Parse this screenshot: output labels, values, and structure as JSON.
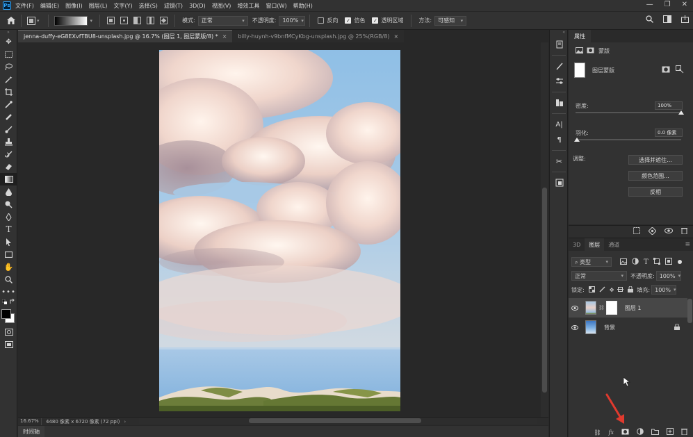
{
  "app": {
    "logo": "Ps"
  },
  "menu": [
    "文件(F)",
    "编辑(E)",
    "图像(I)",
    "图层(L)",
    "文字(Y)",
    "选择(S)",
    "滤镜(T)",
    "3D(D)",
    "视图(V)",
    "增效工具",
    "窗口(W)",
    "帮助(H)"
  ],
  "window_controls": {
    "minimize": "—",
    "restore": "❐",
    "close": "✕"
  },
  "options": {
    "mode_label": "模式:",
    "mode_value": "正常",
    "opacity_label": "不透明度:",
    "opacity_value": "100%",
    "reverse_label": "反向",
    "dither_label": "仿色",
    "transparency_label": "透明区域",
    "method_label": "方法:",
    "method_value": "可感知"
  },
  "tabs": [
    {
      "label": "jenna-duffy-eG8EXvfTBU8-unsplash.jpg @ 16.7% (图层 1, 图层蒙版/8) *",
      "close": "×"
    },
    {
      "label": "billy-huynh-v9bnfMCyKbg-unsplash.jpg @ 25%(RGB/8)",
      "close": "×"
    }
  ],
  "status": {
    "zoom": "16.67%",
    "info": "4480 像素 x 6720 像素 (72 ppi)"
  },
  "timeline": {
    "label": "时间轴"
  },
  "properties": {
    "tab": "属性",
    "mask_type": "蒙版",
    "layer_mask_label": "图层蒙版",
    "density_label": "密度:",
    "density_value": "100%",
    "density": 1.0,
    "feather_label": "羽化:",
    "feather_value": "0.0 像素",
    "feather": 0.0,
    "adjust_label": "调整:",
    "btn_select_mask": "选择并遮住...",
    "btn_color_range": "颜色范围...",
    "btn_invert": "反相"
  },
  "layers_panel": {
    "tabs": [
      "3D",
      "图层",
      "通道"
    ],
    "filter_kind": "类型",
    "blend_mode": "正常",
    "opacity_label": "不透明度:",
    "opacity_value": "100%",
    "lock_label": "锁定:",
    "fill_label": "填充:",
    "fill_value": "100%",
    "layers": [
      {
        "name": "图层 1"
      },
      {
        "name": "背景"
      }
    ],
    "footer_fx": "fx"
  },
  "colors": {
    "accent": "#31a8ff",
    "panel": "#323232",
    "canvas": "#282828",
    "annotation_arrow": "#e03a2e"
  }
}
